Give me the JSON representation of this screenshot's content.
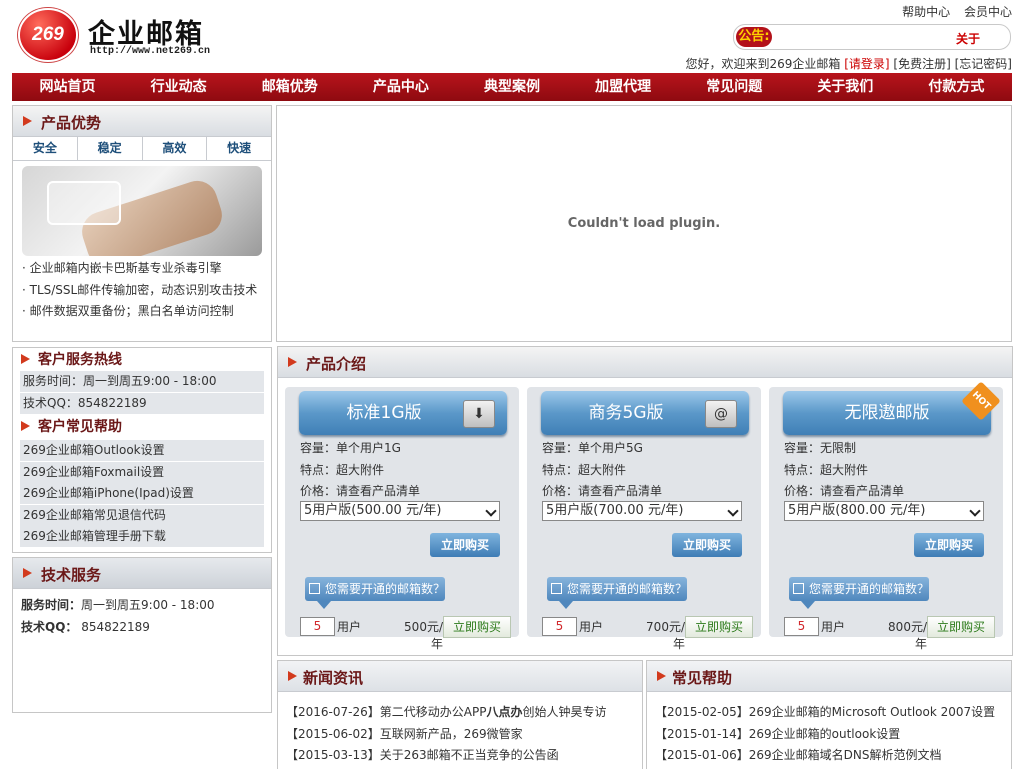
{
  "header": {
    "logo_mark": "269",
    "logo_title": "企业邮箱",
    "logo_url": "http://www.net269.cn",
    "top_links": [
      "帮助中心",
      "会员中心"
    ],
    "notice_label": "公告:",
    "notice_text": "关于",
    "welcome_prefix": "您好，欢迎来到269企业邮箱",
    "login_link": "[请登录]",
    "register_link": "[免费注册]",
    "forgot_link": "[忘记密码]"
  },
  "nav": [
    "网站首页",
    "行业动态",
    "邮箱优势",
    "产品中心",
    "典型案例",
    "加盟代理",
    "常见问题",
    "关于我们",
    "付款方式"
  ],
  "advantages": {
    "title": "产品优势",
    "tabs": [
      "安全",
      "稳定",
      "高效",
      "快速"
    ],
    "bullets": [
      "· 企业邮箱内嵌卡巴斯基专业杀毒引擎",
      "· TLS/SSL邮件传输加密，动态识别攻击技术",
      "· 邮件数据双重备份；黑白名单访问控制"
    ]
  },
  "plugin": {
    "message": "Couldn't load plugin."
  },
  "hotline": {
    "title": "客户服务热线",
    "rows": [
      "服务时间：周一到周五9:00 - 18:00",
      "技术QQ：854822189"
    ],
    "help_title": "客户常见帮助",
    "help_items": [
      "269企业邮箱Outlook设置",
      "269企业邮箱Foxmail设置",
      "269企业邮箱iPhone(Ipad)设置",
      "269企业邮箱常见退信代码",
      "269企业邮箱管理手册下载"
    ]
  },
  "tech": {
    "title": "技术服务",
    "hours_label": "服务时间：",
    "hours_value": "周一到周五9:00 - 18:00",
    "qq_label": "技术QQ：",
    "qq_value": " 854822189"
  },
  "products": {
    "title": "产品介绍",
    "cards": [
      {
        "name": "标准1G版",
        "icon": "download-icon",
        "capacity": "容量：单个用户1G",
        "feature": "特点：超大附件",
        "price_line": "价格：请查看产品清单",
        "select": "5用户版(500.00 元/年)",
        "buy": "立即购买",
        "tip": "您需要开通的邮箱数？",
        "qty": "5",
        "unit": "用户",
        "price": "500元/年",
        "buy2": "立即购买",
        "hot": ""
      },
      {
        "name": "商务5G版",
        "icon": "mail-add-icon",
        "capacity": "容量：单个用户5G",
        "feature": "特点：超大附件",
        "price_line": "价格：请查看产品清单",
        "select": "5用户版(700.00 元/年)",
        "buy": "立即购买",
        "tip": "您需要开通的邮箱数？",
        "qty": "5",
        "unit": "用户",
        "price": "700元/年",
        "buy2": "立即购买",
        "hot": ""
      },
      {
        "name": "无限遨邮版",
        "icon": "",
        "capacity": "容量：无限制",
        "feature": "特点：超大附件",
        "price_line": "价格：请查看产品清单",
        "select": "5用户版(800.00 元/年)",
        "buy": "立即购买",
        "tip": "您需要开通的邮箱数？",
        "qty": "5",
        "unit": "用户",
        "price": "800元/年",
        "buy2": "立即购买",
        "hot": "HOT"
      }
    ]
  },
  "news": {
    "title": "新闻资讯",
    "items": [
      {
        "date": "【2016-07-26】",
        "pre": "第二代移动办公APP",
        "bold": "八点办",
        "post": "创始人钟昊专访"
      },
      {
        "date": "【2015-06-02】",
        "pre": "互联网新产品，269微管家",
        "bold": "",
        "post": ""
      },
      {
        "date": "【2015-03-13】",
        "pre": "关于263邮箱不正当竞争的公告函",
        "bold": "",
        "post": ""
      }
    ]
  },
  "faq": {
    "title": "常见帮助",
    "items": [
      {
        "date": "【2015-02-05】",
        "text": "269企业邮箱的Microsoft Outlook 2007设置"
      },
      {
        "date": "【2015-01-14】",
        "text": "269企业邮箱的outlook设置"
      },
      {
        "date": "【2015-01-06】",
        "text": "269企业邮箱域名DNS解析范例文档"
      }
    ]
  },
  "colors": {
    "brand_red": "#b3121a",
    "nav_blue": "#3f7fb6"
  }
}
